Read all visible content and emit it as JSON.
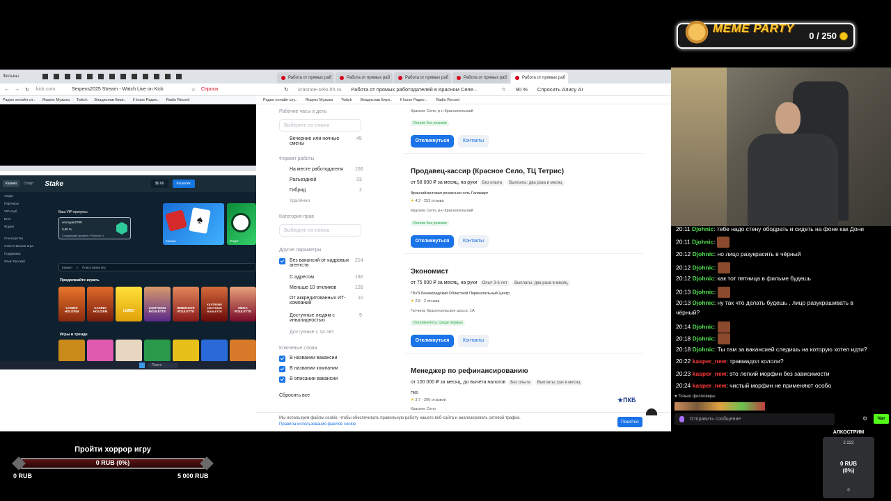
{
  "meme": {
    "title": "MEME PARTY",
    "count": "0 / 250"
  },
  "left_browser": {
    "tabs": [
      "Фильмы"
    ],
    "url": "kick.com",
    "page_title": "Serpens2025 Stream - Watch Live on Kick",
    "alice": "Спроси",
    "bookmarks": [
      "Радио онлайн сл..",
      "Яндекс Музыка",
      "Twitch",
      "Владислав Кири..",
      "Il louse Радио..",
      "Radio Record"
    ]
  },
  "stake": {
    "logo": "Stake",
    "balance": "$0.00",
    "wallet": "Кошелек",
    "tabs": [
      "Казино",
      "Спорт"
    ],
    "side": [
      "Акции",
      "Партнеры",
      "VIP-клуб",
      "Блог",
      "Форум",
      "Спонсорство",
      "Ответственная игра",
      "Поддержка",
      "Язык: Русский"
    ],
    "vip_title": "Ваш VIP-прогресс",
    "user": "ocoruyan2799",
    "progress": "0,00 %",
    "next_level": "Следующий уровень: Platinum II",
    "promo_casino": "Казино",
    "promo_sport": "Спорт",
    "search_tab": "Казино",
    "search_placeholder": "Поиск своих игр",
    "continue": "Продолжайте играть",
    "trend": "Игры в тренде",
    "games": [
      "CASINO HOLD'EM",
      "CASINO HOLD'EM",
      "LIMBO",
      "LIGHTNING ROULETTE",
      "IMMERSIVE ROULETTE",
      "XXXTREME LIGHTNING ROULETTE",
      "MEGA ROULETTE"
    ],
    "taskbar_search": "Поиск"
  },
  "mid_browser": {
    "tabs": [
      "Работа от прямых раб",
      "Работа от прямых раб",
      "Работа от прямых раб",
      "Работа от прямых раб",
      "Работа от прямых раб"
    ],
    "url": "krasnoe-selo.hh.ru",
    "page_title": "Работа от прямых работодателей в Красном Селе...",
    "zoom": "90 %",
    "alice": "Спросить Алису AI",
    "bookmarks": [
      "Радио онлайн слу..",
      "Яндекс Музыка",
      "Twitch",
      "Владислав Кири..",
      "Il louse Радио ..",
      "Radio Record"
    ]
  },
  "filters": {
    "work_hours": "Рабочие часы в день",
    "choose": "Выберите из списка",
    "evening": "Вечерние или ночные смены",
    "evening_count": "45",
    "format": "Формат работы",
    "format_items": [
      {
        "label": "На месте работодателя",
        "count": "156"
      },
      {
        "label": "Разъездной",
        "count": "23"
      },
      {
        "label": "Гибрид",
        "count": "2"
      },
      {
        "label": "Удалённо",
        "count": ""
      }
    ],
    "rights": "Категория прав",
    "choose2": "Выберите из списка",
    "other": "Другие параметры",
    "other_items": [
      {
        "label": "Без вакансий от кадровых агентств",
        "count": "214"
      },
      {
        "label": "С адресом",
        "count": "192"
      },
      {
        "label": "Меньше 10 откликов",
        "count": "126"
      },
      {
        "label": "От аккредитованных ИТ-компаний",
        "count": "10"
      },
      {
        "label": "Доступные людям с инвалидностью",
        "count": "9"
      },
      {
        "label": "Доступные с 14 лет",
        "count": ""
      }
    ],
    "keywords": "Ключевые слова",
    "keyword_items": [
      "В названии вакансии",
      "В названии компании",
      "В описании вакансии"
    ],
    "reset": "Сбросить все"
  },
  "vacancies": [
    {
      "location": "Красное Село, р-н Красносельский",
      "badge": "Отклик без резюме",
      "apply": "Откликнуться",
      "contacts": "Контакты"
    },
    {
      "title": "Продавец-кассир (Красное Село, ТЦ Тетрис)",
      "salary": "от 58 000 ₽ за месяц, на руки",
      "tags": [
        "Без опыта",
        "Выплаты: два раза в месяц"
      ],
      "company": "Франчайзинговая розничная сеть Галамарт",
      "rating": "4.2",
      "reviews": "253 отзыва",
      "location": "Красное Село, р-н Красносельский",
      "badge": "Отклик без резюме",
      "apply": "Откликнуться",
      "contacts": "Контакты"
    },
    {
      "title": "Экономист",
      "salary": "от 75 000 ₽ за месяц, на руки",
      "tags": [
        "Опыт 3-6 лет",
        "Выплаты: два раза в месяц"
      ],
      "company": "ГБУЗ Ленинградский Областной Перинатальный Центр",
      "rating": "2.8",
      "reviews": "2 отзыва",
      "location": "Гатчина, Красносельское шоссе, 1А",
      "badge": "Откликнитесь среди первых",
      "apply": "Откликнуться",
      "contacts": "Контакты"
    },
    {
      "title": "Менеджер по рефинансированию",
      "salary": "от 100 000 ₽ за месяц, до вычета налогов",
      "tags": [
        "Без опыта",
        "Выплаты: раз в месяц"
      ],
      "company": "ПКБ",
      "rating": "3.7",
      "reviews": "206 отзывов",
      "location": "Красное Село",
      "logo": "★ПКБ"
    }
  ],
  "cookie": {
    "text": "Мы используем файлы cookie, чтобы обеспечивать правильную работу нашего веб-сайта и анализировать сетевой трафик.",
    "link": "Правила использования файлов cookie",
    "ok": "Понятно"
  },
  "chat": {
    "messages": [
      {
        "time": "20:11",
        "user": "Djohnic",
        "text": "тебе надо стену ободрать и сидеть на фоне как Дони",
        "type": "u1"
      },
      {
        "time": "20:11",
        "user": "Djohnic",
        "text": "",
        "emote": true,
        "type": "u1"
      },
      {
        "time": "20:12",
        "user": "Djohnic",
        "text": "но лицо разукрасить в чёрный",
        "type": "u1"
      },
      {
        "time": "20:12",
        "user": "Djohnic",
        "text": "",
        "emote": true,
        "type": "u1"
      },
      {
        "time": "20:12",
        "user": "Djohnic",
        "text": "как тот пятница в фильме будешь",
        "type": "u1"
      },
      {
        "time": "20:13",
        "user": "Djohnic",
        "text": "",
        "emote": true,
        "type": "u1"
      },
      {
        "time": "20:13",
        "user": "Djohnic",
        "text": "ну так что делать будешь , лицо разукрашивать в",
        "type": "u1"
      },
      {
        "time": "",
        "user": "",
        "text": "чёрный?",
        "type": "u1"
      },
      {
        "time": "20:14",
        "user": "Djohnic",
        "text": "",
        "emote": true,
        "type": "u1"
      },
      {
        "time": "20:18",
        "user": "Djohnic",
        "text": "",
        "emote": true,
        "type": "u1"
      },
      {
        "time": "20:18",
        "user": "Djohnic",
        "text": "Ты там за вакансией следишь на которую хотел идти?",
        "type": "u1"
      },
      {
        "time": "20:22",
        "user": "kasper_new",
        "text": "травмадол кололи?",
        "type": "u2"
      },
      {
        "time": "20:23",
        "user": "kasper_new",
        "text": "это легкий морфин без зависимости",
        "type": "u2"
      },
      {
        "time": "20:24",
        "user": "kasper_new",
        "text": "чистый морфин не применяют особо",
        "type": "u2"
      }
    ],
    "followers_only": "Только фолловеры",
    "placeholder": "Отправить сообщение",
    "send": "Чат"
  },
  "goal": {
    "title": "Пройти хоррор игру",
    "progress": "0 RUB (0%)",
    "min": "0 RUB",
    "max": "5 000 RUB",
    "fraction": 0
  },
  "alco": {
    "title": "АЛКОСТРИМ",
    "value": "0 RUB",
    "pct": "(0%)",
    "top": "2 222",
    "bottom": "0"
  }
}
